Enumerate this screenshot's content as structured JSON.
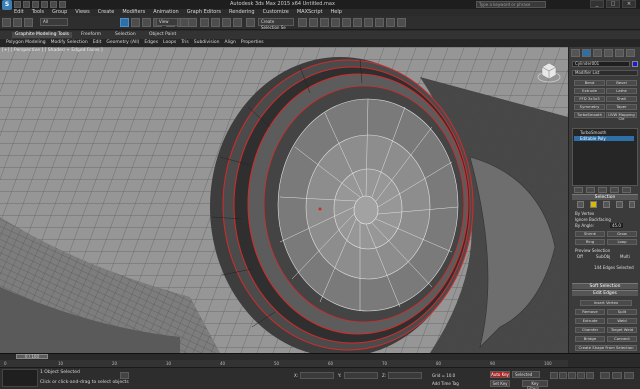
{
  "app": {
    "title": "Autodesk 3ds Max 2015 x64    Untitled.max",
    "logo_text": "S",
    "search_placeholder": "Type a keyword or phrase",
    "window_controls": [
      "_",
      "□",
      "×"
    ]
  },
  "menubar": [
    "Edit",
    "Tools",
    "Group",
    "Views",
    "Create",
    "Modifiers",
    "Animation",
    "Graph Editors",
    "Rendering",
    "Customize",
    "MAXScript",
    "Help"
  ],
  "toolbar": {
    "filter_select": "All",
    "view_select": "View",
    "selection_set": "Create Selection Se"
  },
  "ribbon": {
    "tabs": [
      "Graphite Modeling Tools",
      "Freeform",
      "Selection",
      "Object Paint"
    ],
    "active_tab": "Graphite Modeling Tools",
    "sub_items": [
      "Polygon Modeling",
      "Modify Selection",
      "Edit",
      "Geometry (All)",
      "Edges",
      "Loops",
      "Tris",
      "Subdivision",
      "Align",
      "Properties"
    ]
  },
  "viewport": {
    "label": "[+] [ Perspective ] [ Shaded + Edged Faces ]"
  },
  "command_panel": {
    "object_name": "Cylinder001",
    "modifier_list": "Modifier List",
    "buttons": [
      "Bend",
      "Bevel",
      "Extrude",
      "Lathe",
      "FFD 3x3x3",
      "Shell",
      "Symmetry",
      "Taper",
      "TurboSmooth",
      "UVW Mapping Cle"
    ],
    "stack": [
      "TurboSmooth",
      "Editable Poly"
    ],
    "stack_selected": "Editable Poly",
    "selection_rollout": "Selection",
    "by_vertex": "By Vertex",
    "ignore_backfacing": "Ignore Backfacing",
    "by_angle": "By Angle:",
    "by_angle_value": "45.0",
    "shrink": "Shrink",
    "grow": "Grow",
    "ring": "Ring",
    "loop": "Loop",
    "preview_selection": "Preview Selection",
    "preview_options": [
      "Off",
      "SubObj",
      "Multi"
    ],
    "edges_selected": "144 Edges Selected",
    "soft_selection": "Soft Selection",
    "edit_edges": "Edit Edges",
    "insert_vertex": "Insert Vertex",
    "remove": "Remove",
    "split": "Split",
    "extrude": "Extrude",
    "weld": "Weld",
    "chamfer": "Chamfer",
    "target_weld": "Target Weld",
    "bridge": "Bridge",
    "connect": "Connect",
    "create_shape": "Create Shape From Selection",
    "weight_label": "Weight:",
    "weight_value": "1.0"
  },
  "timeline": {
    "slider": "0 / 100",
    "ticks": [
      "0",
      "10",
      "20",
      "30",
      "40",
      "50",
      "60",
      "70",
      "80",
      "90",
      "100"
    ]
  },
  "statusbar": {
    "selection_status": "1 Object Selected",
    "prompt": "Click or click-and-drag to select objects",
    "x_label": "X:",
    "y_label": "Y:",
    "z_label": "Z:",
    "grid": "Grid = 10.0",
    "add_time_tag": "Add Time Tag",
    "auto_key": "Auto Key",
    "set_key": "Set Key",
    "selected_dropdown": "Selected",
    "key_filters": "Key Filters..."
  },
  "colors": {
    "selected_edge": "#d62a2a",
    "object_color": "#1a1ad8",
    "accent": "#2f6fa8"
  }
}
